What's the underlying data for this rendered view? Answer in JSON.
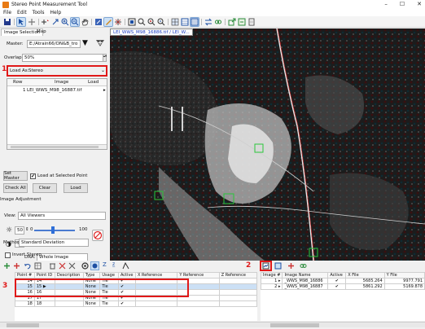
{
  "window": {
    "title": "Stereo Point Measurement Tool",
    "controls": [
      "–",
      "☐",
      "✕"
    ]
  },
  "menu": [
    "File",
    "Edit",
    "Tools",
    "Help"
  ],
  "left": {
    "tabs": [
      "Image Selection",
      "Map"
    ],
    "master_label": "Master:",
    "master_value": "E:/Atrain66/ON&B_tro",
    "overlap_label": "Overlap:",
    "overlap_value": "50%",
    "load_as_label": "Load As:",
    "load_as_value": "Stereo",
    "list_headers": [
      "Row",
      "Image",
      "Load"
    ],
    "list_rows": [
      {
        "row": "1",
        "image": "LEI_WWS_M98_16887.tif",
        "load": "▸"
      }
    ],
    "set_master": "Set Master",
    "load_selected": "Load at Selected Point",
    "check_all": "Check All",
    "clear": "Clear",
    "load": "Load",
    "image_adjustment": "Image Adjustment",
    "view_label": "View:",
    "view_value": "All Viewers",
    "brightness": "50",
    "contrast": "50",
    "slider_max_1": "100",
    "slider_max_2": "100",
    "dra_label": "DRA:",
    "dra_value": "Whole Image",
    "method_label": "Method:",
    "method_value": "Standard Deviation",
    "invert_stereo": "Invert Stereo"
  },
  "viewer": {
    "tab_label": "LEI_WWS_M98_16886.tif / LEI_W..."
  },
  "annotations": {
    "label1": "1",
    "label2": "2",
    "label3": "3"
  },
  "points_table": {
    "headers": [
      "Point #",
      "Point ID",
      "Description",
      "Type",
      "Usage",
      "Active",
      "X Reference",
      "Y Reference",
      "Z Reference"
    ],
    "rows": [
      {
        "num": "14",
        "id": "14",
        "desc": "",
        "type": "None",
        "usage": "Tie",
        "active": "✔"
      },
      {
        "num": "15",
        "id": "15",
        "desc": "",
        "type": "None",
        "usage": "Tie",
        "active": "✔"
      },
      {
        "num": "16",
        "id": "16",
        "desc": "",
        "type": "None",
        "usage": "Tie",
        "active": "✔"
      },
      {
        "num": "17",
        "id": "17",
        "desc": "",
        "type": "None",
        "usage": "Tie",
        "active": "✔"
      },
      {
        "num": "18",
        "id": "18",
        "desc": "",
        "type": "None",
        "usage": "Tie",
        "active": "✔"
      }
    ]
  },
  "images_table": {
    "headers": [
      "Image #",
      "Image Name",
      "Active",
      "X File",
      "Y File"
    ],
    "rows": [
      {
        "num": "1",
        "name": "_WWS_M98_16886",
        "active": "✔",
        "x": "5685.264",
        "y": "9977.791"
      },
      {
        "num": "2",
        "name": "_WWS_M98_16887",
        "active": "✔",
        "x": "5861.292",
        "y": "5169.878"
      }
    ]
  },
  "colors": {
    "highlight_red": "#e01919",
    "selection_blue": "#cce0f5"
  }
}
